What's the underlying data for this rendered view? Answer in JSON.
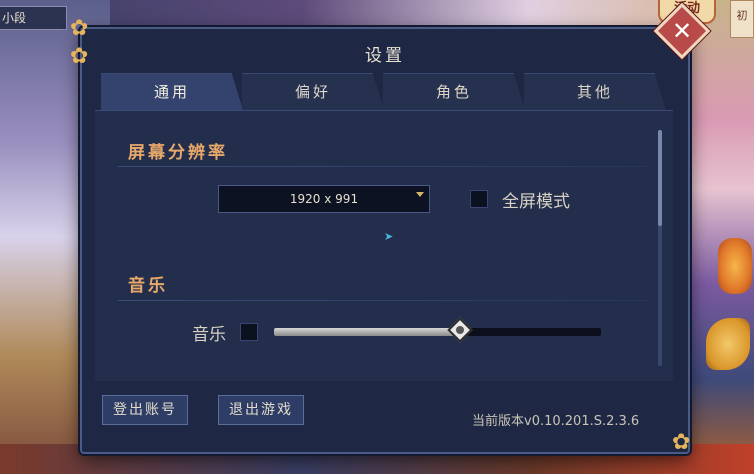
{
  "background": {
    "level_tag": "小段",
    "activity_tag": "活动",
    "side_tag": "初"
  },
  "panel": {
    "title": "设置",
    "close_symbol": "✕"
  },
  "tabs": [
    {
      "label": "通用",
      "active": true
    },
    {
      "label": "偏好",
      "active": false
    },
    {
      "label": "角色",
      "active": false
    },
    {
      "label": "其他",
      "active": false
    }
  ],
  "resolution": {
    "header": "屏幕分辨率",
    "value": "1920 x 991",
    "fullscreen_label": "全屏模式",
    "fullscreen_checked": false
  },
  "audio": {
    "header": "音乐",
    "music_label": "音乐",
    "music_muted_checked": false,
    "music_volume_fraction": 0.57
  },
  "footer": {
    "logout_label": "登出账号",
    "exit_label": "退出游戏",
    "version": "当前版本v0.10.201.S.2.3.6"
  },
  "colors": {
    "panel_bg": "#1e2845",
    "section_header": "#e8a86a",
    "close_button": "#b84a4a",
    "tab_active": "#33436d"
  }
}
